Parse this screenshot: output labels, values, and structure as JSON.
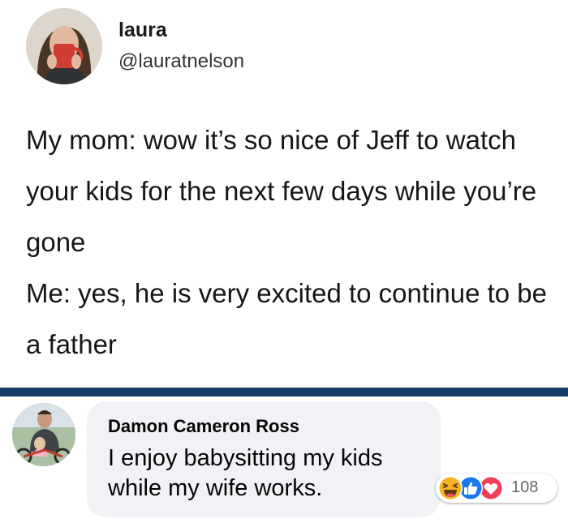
{
  "tweet": {
    "display_name": "laura",
    "handle": "@lauratnelson",
    "paragraphs": [
      "My mom: wow it’s so nice of Jeff to watch your kids for the next few days while you’re gone",
      "Me: yes, he is very excited to continue to be a father"
    ]
  },
  "comment": {
    "author": "Damon Cameron Ross",
    "text": "I enjoy babysitting my kids while my wife works.",
    "reactions": {
      "icons": [
        "haha-icon",
        "like-icon",
        "love-icon"
      ],
      "count": "108"
    }
  },
  "colors": {
    "divider": "#163a63",
    "bubble": "#f0f2f5",
    "like": "#1877f2",
    "love": "#f33e58",
    "haha": "#f7b125"
  }
}
